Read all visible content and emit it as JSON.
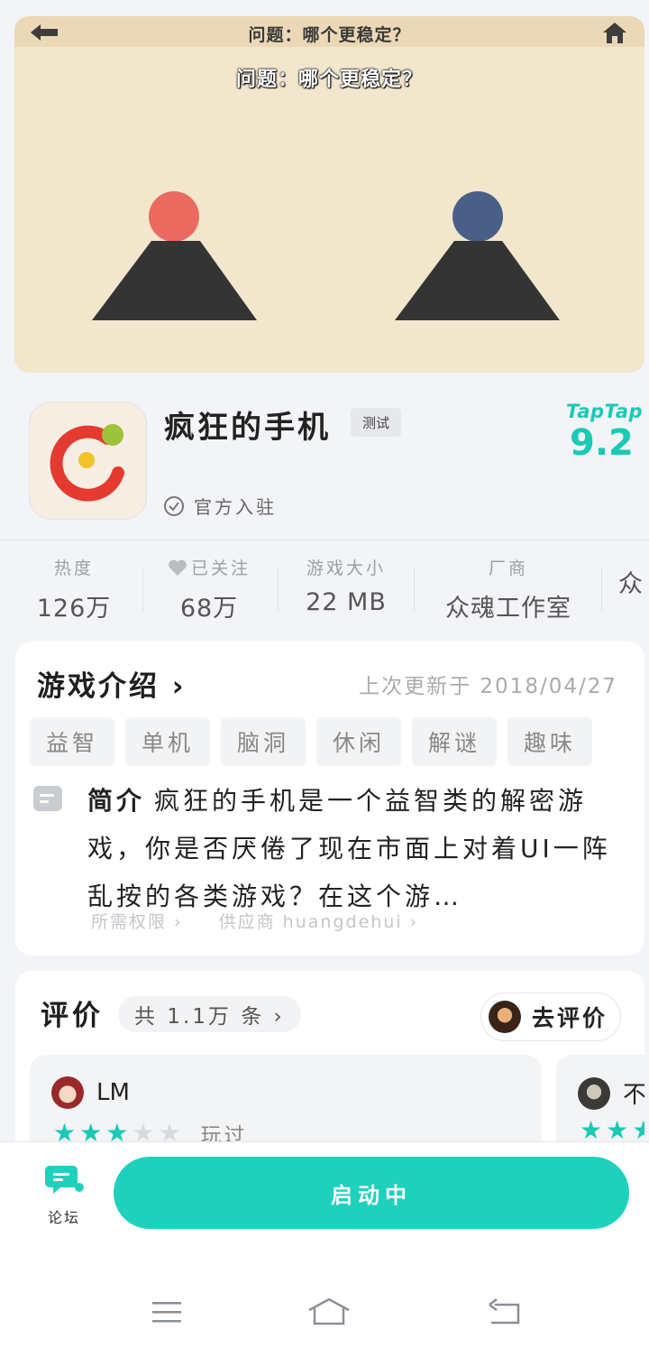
{
  "hero": {
    "question_top": "问题：哪个更稳定？",
    "question_main": "问题：哪个更稳定？"
  },
  "app": {
    "title": "疯狂的手机",
    "badge": "测试",
    "official": "官方入驻",
    "brand": "TapTap",
    "score": "9.2"
  },
  "stats": [
    {
      "label": "热度",
      "value": "126万"
    },
    {
      "label": "已关注",
      "value": "68万"
    },
    {
      "label": "游戏大小",
      "value": "22 MB"
    },
    {
      "label": "厂商",
      "value": "众魂工作室"
    },
    {
      "label": "",
      "value": "众"
    }
  ],
  "intro": {
    "title": "游戏介绍 ›",
    "updated": "上次更新于 2018/04/27",
    "tags": [
      "益智",
      "单机",
      "脑洞",
      "休闲",
      "解谜",
      "趣味"
    ],
    "desc_title": "简介",
    "desc_text": "疯狂的手机是一个益智类的解密游戏，你是否厌倦了现在市面上对着UI一阵乱按的各类游戏？在这个游…",
    "permissions": "所需权限 ›",
    "provider": "供应商 huangdehui ›"
  },
  "reviews": {
    "title": "评价",
    "count": "共 1.1万 条 ›",
    "go_review": "去评价",
    "items": [
      {
        "user": "LM",
        "status": "玩过",
        "rating": 3
      },
      {
        "user": "不",
        "status": "",
        "rating": 3
      }
    ]
  },
  "bottom": {
    "forum": "论坛",
    "launch": "启动中"
  },
  "colors": {
    "accent": "#1fd1bd",
    "hero_bg": "#f2e6cd",
    "red_ball": "#ea6a5f",
    "blue_ball": "#4a5f86"
  },
  "icons": [
    "back-arrow-icon",
    "home-icon",
    "check-circle-icon",
    "heart-icon",
    "doc-icon",
    "star-icon",
    "forum-icon",
    "menu-icon",
    "home-nav-icon",
    "back-nav-icon"
  ]
}
